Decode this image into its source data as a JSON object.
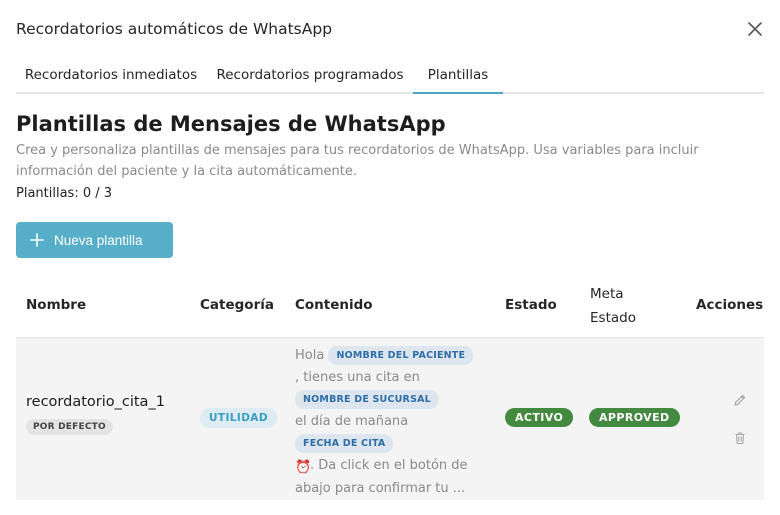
{
  "modal": {
    "title": "Recordatorios automáticos de WhatsApp",
    "close_icon": "close-icon"
  },
  "tabs": [
    {
      "label": "Recordatorios inmediatos",
      "active": false
    },
    {
      "label": "Recordatorios programados",
      "active": false
    },
    {
      "label": "Plantillas",
      "active": true
    }
  ],
  "section": {
    "title": "Plantillas de Mensajes de WhatsApp",
    "description": "Crea y personaliza plantillas de mensajes para tus recordatorios de WhatsApp. Usa variables para incluir información del paciente y la cita automáticamente.",
    "count": "Plantillas: 0 / 3"
  },
  "new_button": {
    "label": "Nueva plantilla",
    "icon": "plus-icon"
  },
  "table": {
    "headers": {
      "name": "Nombre",
      "category": "Categoría",
      "content": "Contenido",
      "status": "Estado",
      "meta_line1": "Meta",
      "meta_line2": "Estado",
      "actions": "Acciones"
    },
    "rows": [
      {
        "name": "recordatorio_cita_1",
        "default_badge": "POR DEFECTO",
        "category": "UTILIDAD",
        "content": {
          "t1": "Hola",
          "v1": "NOMBRE DEL PACIENTE",
          "t2": ", tienes una cita en",
          "v2": "NOMBRE DE SUCURSAL",
          "t3": "el día de mañana",
          "v3": "FECHA DE CITA",
          "alarm": "⏰",
          "t4": ". Da click en el botón de",
          "t5": "abajo para confirmar tu ..."
        },
        "status": "ACTIVO",
        "meta_status": "APPROVED"
      }
    ]
  },
  "colors": {
    "accent": "#57aec8",
    "tab_underline": "#4aa8c6",
    "green": "#43893f",
    "chip_bg": "#dde6ee",
    "chip_text": "#2e6ea8"
  }
}
